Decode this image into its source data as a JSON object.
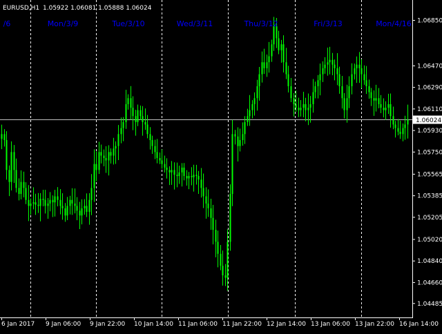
{
  "header": {
    "symbol_text": "EURUSD,H1",
    "ohlc_text": "1.05922 1.06081 1.05888 1.06024"
  },
  "colors": {
    "background": "#000000",
    "candle": "#00ff00",
    "grid": "#ffffff",
    "day_label": "#0000ff",
    "text": "#ffffff",
    "price_line": "#c0c0c0",
    "price_box_bg": "#ffffff",
    "price_box_text": "#000000"
  },
  "chart_data": {
    "type": "candlestick",
    "title": "EURUSD,H1",
    "ylim": [
      1.0438,
      1.0702
    ],
    "y_ticks": [
      "1.06850",
      "1.06470",
      "1.06290",
      "1.06110",
      "1.05930",
      "1.05750",
      "1.05565",
      "1.05385",
      "1.05205",
      "1.05020",
      "1.04840",
      "1.04660",
      "1.04485"
    ],
    "x_ticks": [
      "6 Jan 2017",
      "9 Jan 06:00",
      "9 Jan 22:00",
      "10 Jan 14:00",
      "11 Jan 06:00",
      "11 Jan 22:00",
      "12 Jan 14:00",
      "13 Jan 06:00",
      "13 Jan 22:00",
      "16 Jan 14:00"
    ],
    "day_labels": [
      "/6",
      "Mon/3/9",
      "Tue/3/10",
      "Wed/3/11",
      "Thu/3/12",
      "Fri/3/13",
      "Mon/4/16"
    ],
    "current_price": "1.06024",
    "ohlc": {
      "open": 1.05922,
      "high": 1.06081,
      "low": 1.05888,
      "close": 1.06024
    },
    "close_series": [
      1.059,
      1.0585,
      1.056,
      1.055,
      1.0575,
      1.056,
      1.0545,
      1.054,
      1.055,
      1.0545,
      1.0535,
      1.053,
      1.0532,
      1.0533,
      1.0531,
      1.053,
      1.0536,
      1.0535,
      1.053,
      1.0532,
      1.0535,
      1.0533,
      1.0538,
      1.0535,
      1.053,
      1.0528,
      1.0522,
      1.053,
      1.0535,
      1.0532,
      1.053,
      1.0526,
      1.0522,
      1.0528,
      1.053,
      1.0525,
      1.0535,
      1.0545,
      1.0565,
      1.056,
      1.0575,
      1.0572,
      1.057,
      1.0568,
      1.0575,
      1.0572,
      1.0578,
      1.058,
      1.059,
      1.0595,
      1.06,
      1.0615,
      1.062,
      1.0612,
      1.0605,
      1.06,
      1.061,
      1.0605,
      1.06,
      1.0598,
      1.059,
      1.0585,
      1.058,
      1.0575,
      1.057,
      1.0568,
      1.0565,
      1.0562,
      1.056,
      1.0558,
      1.056,
      1.0556,
      1.0555,
      1.0558,
      1.0562,
      1.0555,
      1.0553,
      1.0555,
      1.0554,
      1.0556,
      1.0555,
      1.0552,
      1.0545,
      1.0538,
      1.0532,
      1.0528,
      1.052,
      1.051,
      1.05,
      1.049,
      1.048,
      1.0472,
      1.047,
      1.05,
      1.054,
      1.059,
      1.0588,
      1.058,
      1.0585,
      1.059,
      1.06,
      1.0605,
      1.061,
      1.0615,
      1.062,
      1.063,
      1.064,
      1.065,
      1.0645,
      1.065,
      1.0655,
      1.0665,
      1.068,
      1.067,
      1.066,
      1.0665,
      1.065,
      1.064,
      1.063,
      1.062,
      1.0615,
      1.0612,
      1.061,
      1.0612,
      1.0615,
      1.061,
      1.0612,
      1.0615,
      1.0625,
      1.063,
      1.0635,
      1.064,
      1.0645,
      1.0648,
      1.065,
      1.0652,
      1.0648,
      1.0645,
      1.064,
      1.063,
      1.062,
      1.061,
      1.062,
      1.063,
      1.064,
      1.0645,
      1.0648,
      1.0645,
      1.064,
      1.0635,
      1.063,
      1.0625,
      1.062,
      1.0618,
      1.062,
      1.0615,
      1.0612,
      1.061,
      1.0612,
      1.0615,
      1.0605,
      1.0598,
      1.0595,
      1.0592,
      1.059,
      1.0595,
      1.0598,
      1.0602
    ]
  }
}
